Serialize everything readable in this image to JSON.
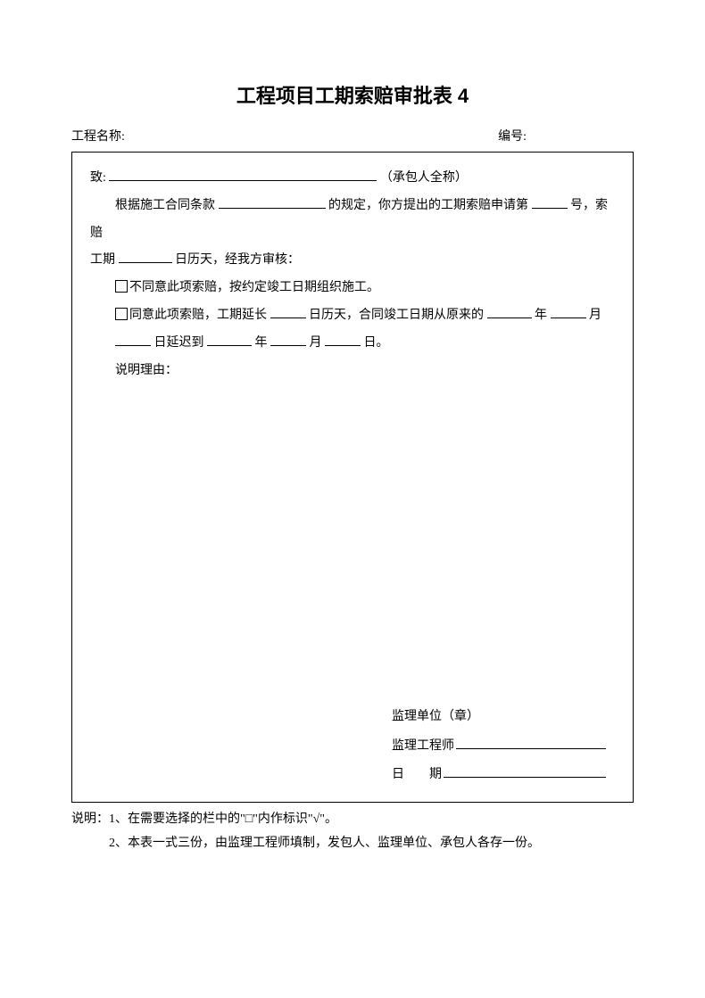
{
  "title": "工程项目工期索赔审批表 4",
  "header": {
    "project_label": "工程名称:",
    "number_label": "编号:"
  },
  "body": {
    "to_label": "致:",
    "to_suffix": "（承包人全称）",
    "p1_a": "根据施工合同条款",
    "p1_b": "的规定，你方提出的工期索赔申请第",
    "p1_c": "号，索赔",
    "p2_a": "工期",
    "p2_b": "日历天，经我方审核：",
    "opt1": "不同意此项索赔，按约定竣工日期组织施工。",
    "opt2_a": "同意此项索赔，工期延长",
    "opt2_b": "日历天，合同竣工日期从原来的",
    "opt2_c": "年",
    "opt2_d": "月",
    "opt3_a": "日延迟到",
    "opt3_b": "年",
    "opt3_c": "月",
    "opt3_d": "日。",
    "reason_label": "说明理由："
  },
  "sig": {
    "unit": "监理单位（章）",
    "engineer": "监理工程师",
    "date": "日　　期"
  },
  "notes": {
    "line1": "说明：1、在需要选择的栏中的\"□\"内作标识\"√\"。",
    "line2": "2、本表一式三份，由监理工程师填制，发包人、监理单位、承包人各存一份。"
  }
}
